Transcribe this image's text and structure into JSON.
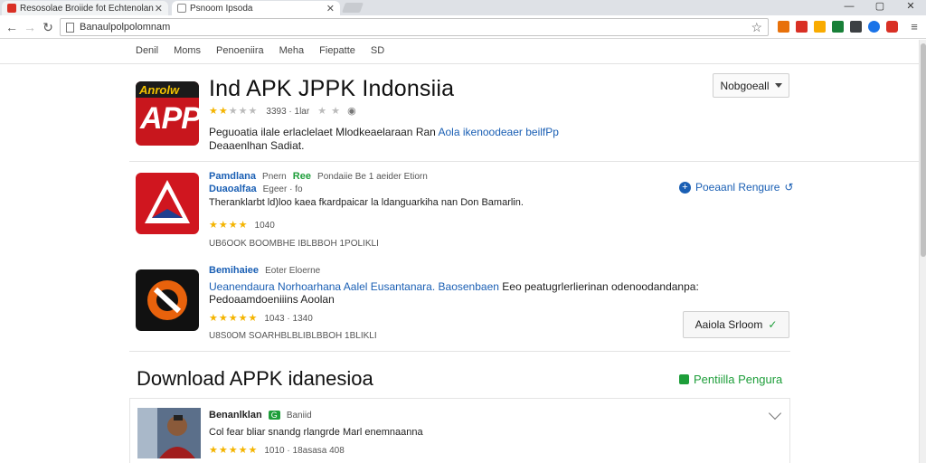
{
  "browser": {
    "tabs": [
      {
        "title": "Resosolae Broiide fot Echtenolan"
      },
      {
        "title": "Psnoom Ipsoda"
      }
    ],
    "address": "Banaulpolpolomnam"
  },
  "nav": {
    "items": [
      "Denil",
      "Moms",
      "Penoeniira",
      "Meha",
      "Fiepatte",
      "SD"
    ]
  },
  "hero": {
    "logo_top": "Anrolw",
    "logo_main": "APP",
    "title": "Ind APK JPPK Indonsiia",
    "rating_stars": "★★",
    "rating_dim_stars": "★★★",
    "rating_meta": "3393 · 1lar",
    "rating_extra_stars": "★ ★",
    "description": "Peguoatia ilale erlaclelaet Mlodkeaelaraan Ran",
    "description_link": "Aola ikenoodeaer beilfPp",
    "subtitle": "Deaaenlhan Sadiat.",
    "select_label": "Nobgoeall"
  },
  "items": [
    {
      "title": "Pamdlana",
      "tag": "Pnern",
      "badge": "Ree",
      "meta": "Pondaiie Be 1 aeider Etiorn",
      "subtitle": "Duaoalfaa",
      "subtitle_meta": "Egeer  · fo",
      "description": "Theranklarbt ld)loo kaea fkardpaicar la ldanguarkiha nan Don Bamarlin.",
      "stars": "★★★★",
      "rating_count": "1040",
      "stats": "UB6OOK   BOOMBHE IBLBBOH   1POLIKLI",
      "action_label": "Poeaanl Rengure"
    },
    {
      "title": "Bemihaiee",
      "tag": "Eoter Eloerne",
      "description_link": "Ueanendaura Norhoarhana Aalel Eusantanara. Baosenbaen",
      "description": "Eeo peatugrlerlierinan odenoodandanpa:",
      "subtitle_link": "Pedoaamdoeniiins Aoolan",
      "stars": "★★★★★",
      "rating_count": "1043 · 1340",
      "stats": "U8S0OM   SOARHBLBLIBLBBOH   1BLIKLI",
      "action_label": "Aaiola Srloom"
    }
  ],
  "download": {
    "title": "Download APPK idanesioa",
    "link": "Pentiilla Pengura"
  },
  "review": {
    "name": "Benanlklan",
    "badge": "G",
    "tag": "Baniid",
    "text": "Col fear bliar snandg rlangrde Marl enemnaanna",
    "stars": "★★★★★",
    "meta": "1010 · 18asasa 408"
  }
}
